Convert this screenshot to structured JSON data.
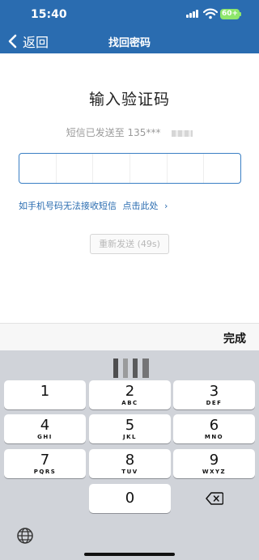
{
  "status_bar": {
    "time": "15:40",
    "battery": "60+"
  },
  "nav": {
    "back_label": "返回",
    "title": "找回密码"
  },
  "verify": {
    "heading": "输入验证码",
    "sent_text": "短信已发送至 135***",
    "help_text": "如手机号码无法接收短信",
    "help_link": "点击此处",
    "help_chevron": "›",
    "resend_label": "重新发送 (49s)",
    "code_cells": 6
  },
  "keyboard": {
    "done_label": "完成",
    "keys": [
      {
        "num": "1",
        "letters": ""
      },
      {
        "num": "2",
        "letters": "ABC"
      },
      {
        "num": "3",
        "letters": "DEF"
      },
      {
        "num": "4",
        "letters": "GHI"
      },
      {
        "num": "5",
        "letters": "JKL"
      },
      {
        "num": "6",
        "letters": "MNO"
      },
      {
        "num": "7",
        "letters": "PQRS"
      },
      {
        "num": "8",
        "letters": "TUV"
      },
      {
        "num": "9",
        "letters": "WXYZ"
      },
      {
        "num": "0",
        "letters": ""
      }
    ]
  },
  "colors": {
    "header": "#2a6cb0",
    "link": "#2a6cb0",
    "battery": "#8ee66b"
  }
}
